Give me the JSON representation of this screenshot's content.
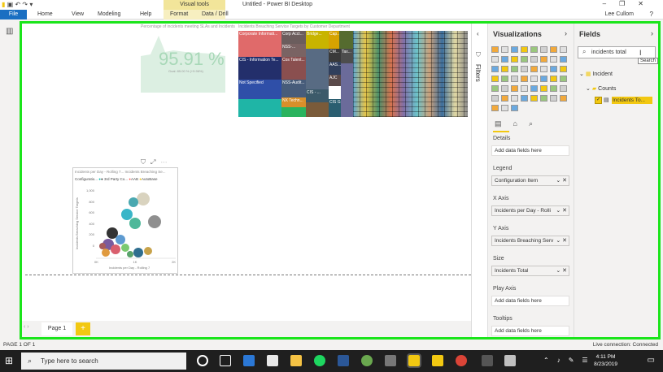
{
  "titlebar": {
    "context_tab": "Visual tools",
    "window_title": "Untitled - Power BI Desktop"
  },
  "menubar": {
    "file": "File",
    "home": "Home",
    "view": "View",
    "modeling": "Modeling",
    "help": "Help",
    "format": "Format",
    "data_drill": "Data / Drill",
    "user": "Lee Cullom"
  },
  "gauge": {
    "title": "Percentage of incidents meeting SLAs and Incidents",
    "value": "95.91 %",
    "goal": "Goal: 85.00 % (+9.96%)"
  },
  "treemap": {
    "title": "Incidents Breaching Service Targets by Customer Department",
    "cells": [
      "Corporate Informati...",
      "Corp Acct...",
      "Bridge...",
      "Cap...",
      "CIS - Information Te...",
      "Cos Talent...",
      "NSS-...",
      "CM...",
      "Not Specified",
      "NSS-Audit...",
      "AAS...",
      "Tax...",
      "AJC",
      "NX Techn...",
      "CIS - ...",
      "CIS G..."
    ]
  },
  "scatter": {
    "title": "Incidents per Day - Rolling 7... Incidents Breaching Se...",
    "legend_label": "Configuratio...",
    "legend_items": [
      "3rd Party Co...",
      "AAB",
      "AutoBase"
    ],
    "ylabel": "Incidents Breaching Service Targets",
    "xlabel": "Incidents per Day - Rolling 7",
    "yticks": [
      "1,000",
      "800",
      "600",
      "400",
      "200",
      "0"
    ],
    "xticks": [
      "0K",
      "1K",
      "2K"
    ]
  },
  "canvas": {
    "page_tab": "Page 1",
    "add_page": "+"
  },
  "filters": {
    "label": "Filters"
  },
  "visualizations": {
    "header": "Visualizations",
    "sections": [
      {
        "label": "Details",
        "value": "Add data fields here",
        "filled": false
      },
      {
        "label": "Legend",
        "value": "Configuration Item",
        "filled": true
      },
      {
        "label": "X Axis",
        "value": "Incidents per Day - Rolli",
        "filled": true
      },
      {
        "label": "Y Axis",
        "value": "Incidents Breaching Serv",
        "filled": true
      },
      {
        "label": "Size",
        "value": "Incidents Total",
        "filled": true
      },
      {
        "label": "Play Axis",
        "value": "Add data fields here",
        "filled": false
      },
      {
        "label": "Tooltips",
        "value": "Add data fields here",
        "filled": false
      }
    ]
  },
  "fields": {
    "header": "Fields",
    "search_value": "incidents total",
    "search_tooltip": "Search",
    "tree": {
      "table": "Incident",
      "folder": "Counts",
      "field": "Incidents To..."
    }
  },
  "status": {
    "left": "PAGE 1 OF 1",
    "right": "Live connection: Connected"
  },
  "taskbar": {
    "search_placeholder": "Type here to search",
    "time": "4:11 PM",
    "date": "8/23/2019"
  },
  "colors": {
    "accent": "#f2c811",
    "frame": "#1ae51a",
    "file_tab": "#1a6fc2"
  }
}
